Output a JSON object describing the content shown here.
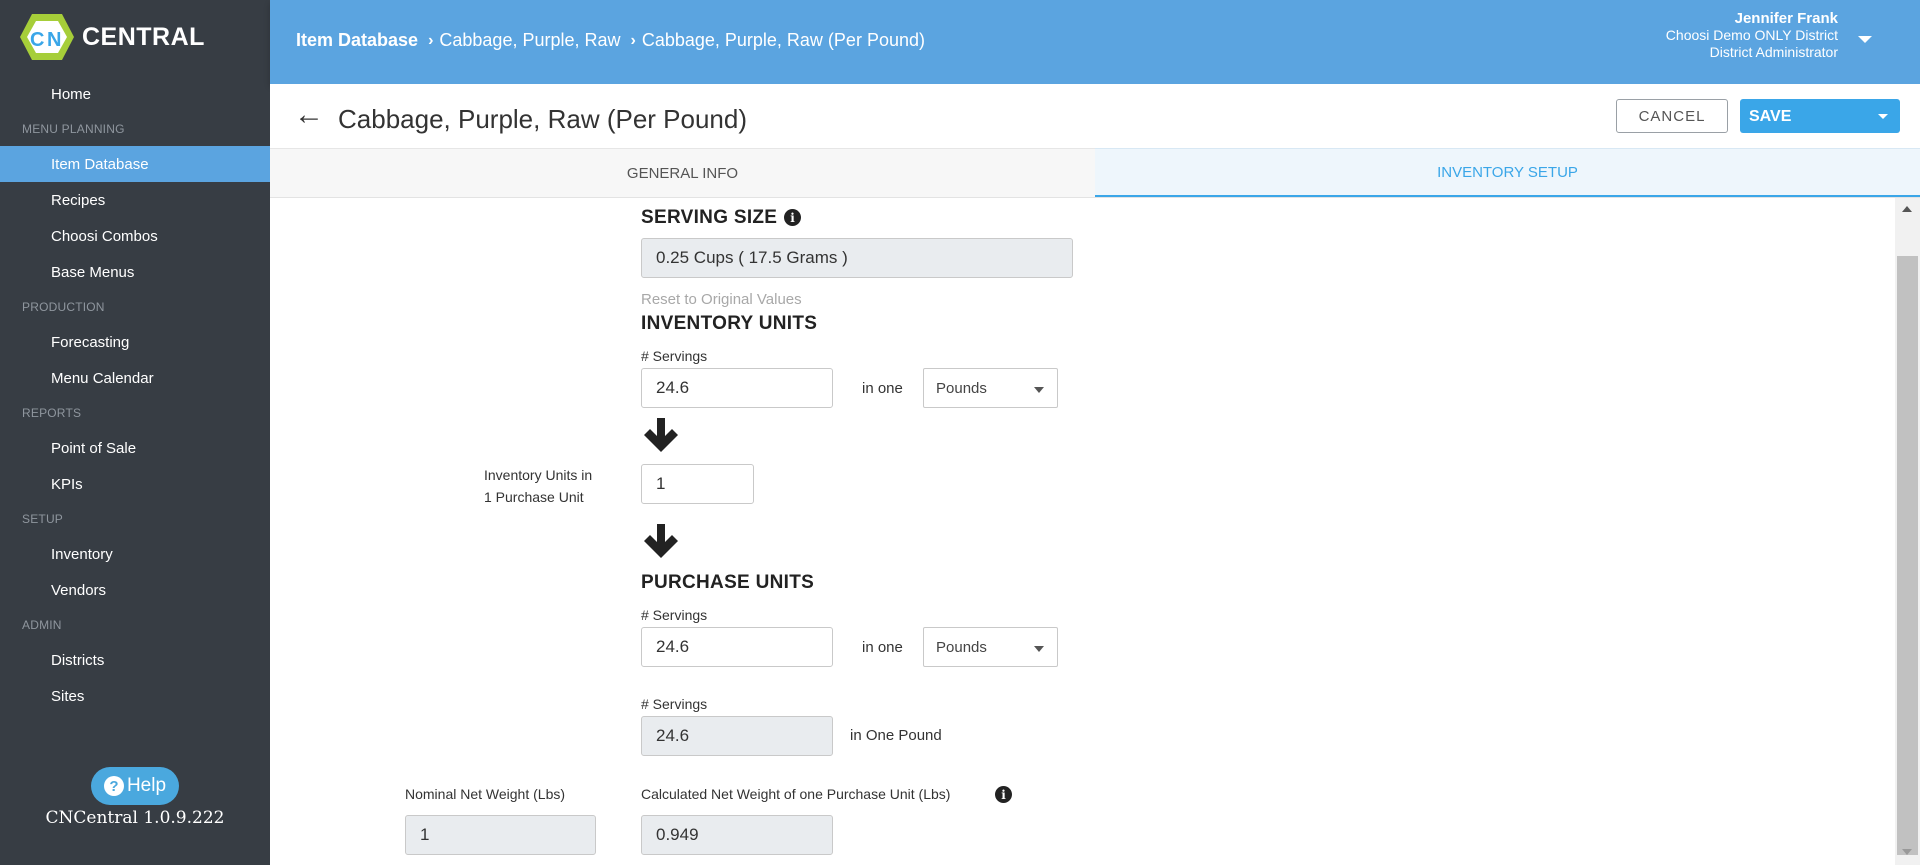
{
  "brand": {
    "logo_letters": "CN",
    "logo_text": "CENTRAL"
  },
  "sidebar": {
    "items": [
      {
        "type": "item",
        "label": "Home"
      },
      {
        "type": "section",
        "label": "MENU PLANNING"
      },
      {
        "type": "item",
        "label": "Item Database",
        "active": true
      },
      {
        "type": "item",
        "label": "Recipes"
      },
      {
        "type": "item",
        "label": "Choosi Combos"
      },
      {
        "type": "item",
        "label": "Base Menus"
      },
      {
        "type": "section",
        "label": "PRODUCTION"
      },
      {
        "type": "item",
        "label": "Forecasting"
      },
      {
        "type": "item",
        "label": "Menu Calendar"
      },
      {
        "type": "section",
        "label": "REPORTS"
      },
      {
        "type": "item",
        "label": "Point of Sale"
      },
      {
        "type": "item",
        "label": "KPIs"
      },
      {
        "type": "section",
        "label": "SETUP"
      },
      {
        "type": "item",
        "label": "Inventory"
      },
      {
        "type": "item",
        "label": "Vendors"
      },
      {
        "type": "section",
        "label": "ADMIN"
      },
      {
        "type": "item",
        "label": "Districts"
      },
      {
        "type": "item",
        "label": "Sites"
      }
    ],
    "help_label": "Help",
    "version": "CNCentral 1.0.9.222"
  },
  "header": {
    "breadcrumb": [
      "Item Database",
      "Cabbage, Purple, Raw",
      "Cabbage, Purple, Raw (Per Pound)"
    ],
    "user": {
      "name": "Jennifer Frank",
      "district": "Choosi Demo ONLY District",
      "role": "District Administrator"
    }
  },
  "title_row": {
    "back_glyph": "←",
    "title": "Cabbage, Purple, Raw (Per Pound)",
    "cancel_label": "CANCEL",
    "save_label": "SAVE"
  },
  "tabs": [
    {
      "label": "GENERAL INFO",
      "active": false
    },
    {
      "label": "INVENTORY SETUP",
      "active": true
    }
  ],
  "form": {
    "serving_size": {
      "heading": "SERVING SIZE",
      "value": "0.25 Cups ( 17.5 Grams )",
      "reset_label": "Reset to Original Values"
    },
    "inventory_units": {
      "heading": "INVENTORY UNITS",
      "servings_label": "# Servings",
      "servings_value": "24.6",
      "in_one_label": "in one",
      "unit": "Pounds"
    },
    "conversion": {
      "label_line1": "Inventory Units in",
      "label_line2": "1 Purchase Unit",
      "value": "1"
    },
    "purchase_units": {
      "heading": "PURCHASE UNITS",
      "servings_label": "# Servings",
      "servings_value": "24.6",
      "in_one_label": "in one",
      "unit": "Pounds"
    },
    "per_pound": {
      "servings_label": "# Servings",
      "servings_value": "24.6",
      "suffix": "in One Pound"
    },
    "nominal_weight": {
      "label": "Nominal Net Weight (Lbs)",
      "value": "1"
    },
    "calculated_weight": {
      "label": "Calculated Net Weight of one Purchase Unit (Lbs)",
      "value": "0.949"
    }
  },
  "colors": {
    "sidebar_bg": "#373d44",
    "header_bg": "#5ba4e0",
    "active_nav": "#5ba4e0",
    "accent": "#3aa6e8"
  }
}
